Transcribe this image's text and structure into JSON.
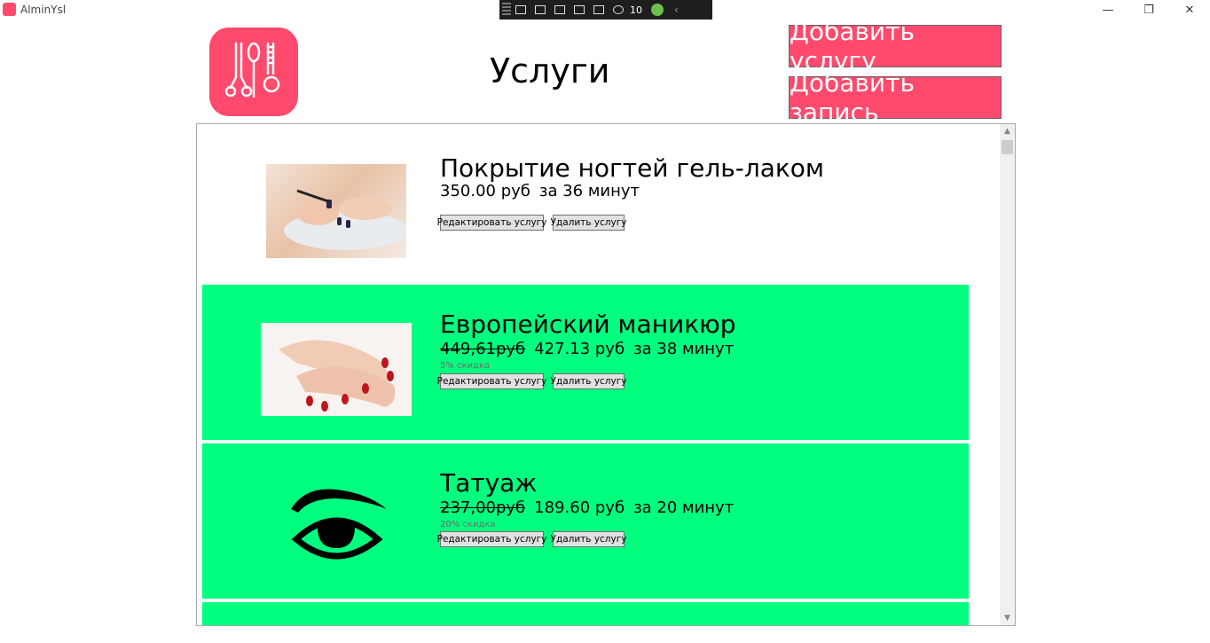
{
  "window": {
    "title": "AlminYsl",
    "minimize_glyph": "—",
    "maximize_glyph": "❐",
    "close_glyph": "✕"
  },
  "devtools": {
    "counter": "10",
    "chevron": "‹"
  },
  "header": {
    "page_title": "Услуги",
    "add_service_label": "Добавить услугу",
    "add_record_label": "Добавить запись",
    "accent_color": "#ff4a6d"
  },
  "services": [
    {
      "name": "Покрытие ногтей гель-лаком",
      "old_price": "",
      "price": "350.00 руб",
      "duration": "за 36 минут",
      "discount": "",
      "image": "gel-polish-photo",
      "highlight": false
    },
    {
      "name": "Европейский маникюр",
      "old_price": "449,61руб",
      "price": "427.13 руб",
      "duration": "за 38 минут",
      "discount": "5% скидка",
      "image": "manicure-photo",
      "highlight": true
    },
    {
      "name": "Татуаж",
      "old_price": "237,00руб",
      "price": "189.60 руб",
      "duration": "за 20 минут",
      "discount": "20% скидка",
      "image": "eye-brow-icon",
      "highlight": true
    }
  ],
  "buttons": {
    "edit_label": "Редактировать услугу",
    "delete_label": "Удалить услугу"
  },
  "scroll": {
    "up_glyph": "▲",
    "down_glyph": "▼"
  },
  "colors": {
    "highlight_row": "#00ff7f",
    "accent": "#ff4a6d"
  }
}
